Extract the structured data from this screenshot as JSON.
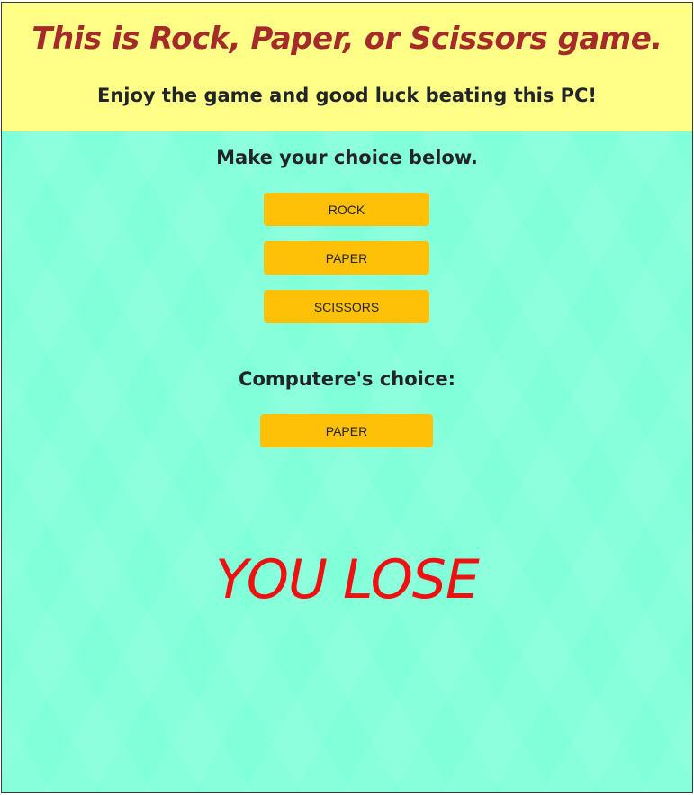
{
  "header": {
    "title": "This is Rock, Paper, or Scissors game.",
    "subtitle": "Enjoy the game and good luck beating this PC!"
  },
  "player": {
    "prompt": "Make your choice below.",
    "choices": [
      "ROCK",
      "PAPER",
      "SCISSORS"
    ]
  },
  "computer": {
    "label": "Computere's choice:",
    "choice": "PAPER"
  },
  "result": {
    "text": "YOU LOSE"
  },
  "colors": {
    "header_bg": "#ffff88",
    "page_bg": "#80ffd8",
    "title": "#a52a2a",
    "button": "#ffc107",
    "result": "#ee1111"
  }
}
